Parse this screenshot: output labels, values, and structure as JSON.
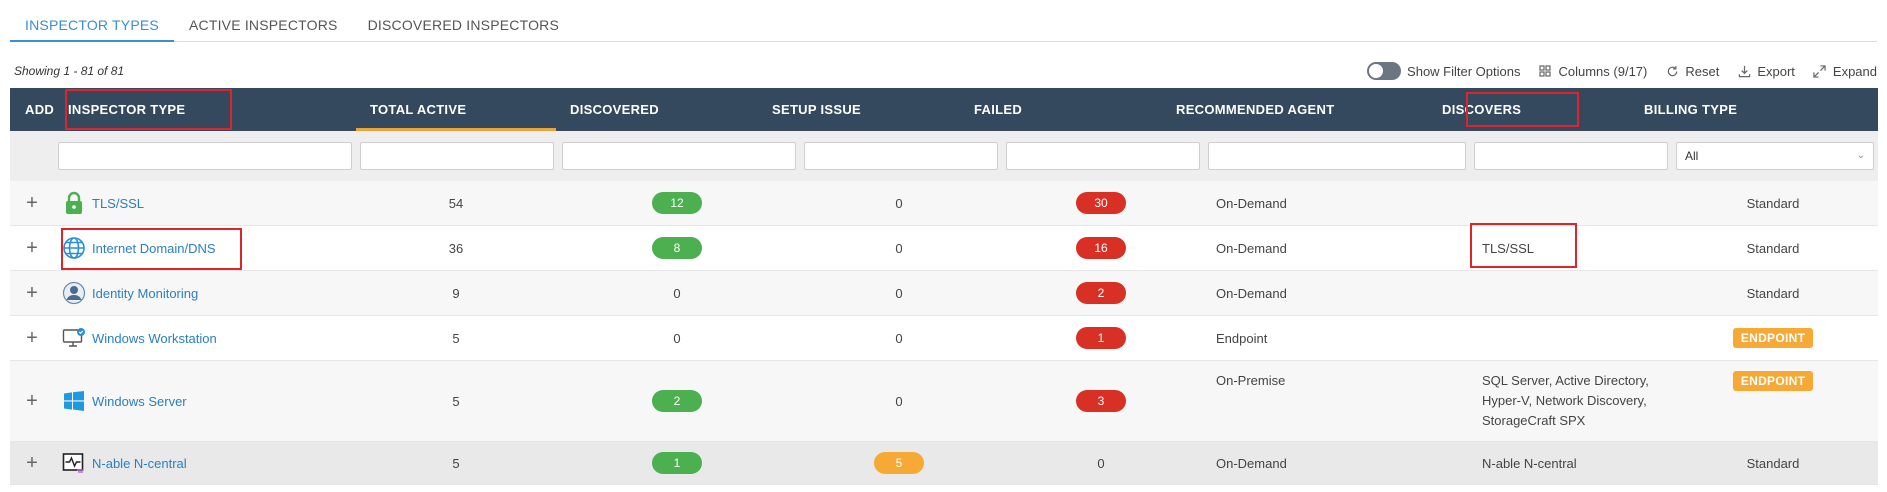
{
  "tabs": [
    {
      "label": "INSPECTOR TYPES",
      "active": true
    },
    {
      "label": "ACTIVE INSPECTORS",
      "active": false
    },
    {
      "label": "DISCOVERED INSPECTORS",
      "active": false
    }
  ],
  "showing": "Showing 1 - 81 of 81",
  "toolbar": {
    "filter_label": "Show Filter Options",
    "columns_label": "Columns (9/17)",
    "reset_label": "Reset",
    "export_label": "Export",
    "expand_label": "Expand"
  },
  "columns": {
    "add": "ADD",
    "type": "INSPECTOR TYPE",
    "total": "TOTAL ACTIVE",
    "discovered": "DISCOVERED",
    "setup": "SETUP ISSUE",
    "failed": "FAILED",
    "agent": "RECOMMENDED AGENT",
    "discovers": "DISCOVERS",
    "billing": "BILLING TYPE"
  },
  "filters": {
    "billing_selected": "All"
  },
  "rows": [
    {
      "type": "TLS/SSL",
      "icon": "lock-icon",
      "total": "54",
      "discovered": "12",
      "setup": "0",
      "failed": "30",
      "agent": "On-Demand",
      "discovers": "",
      "billing": "Standard"
    },
    {
      "type": "Internet Domain/DNS",
      "icon": "globe-icon",
      "total": "36",
      "discovered": "8",
      "setup": "0",
      "failed": "16",
      "agent": "On-Demand",
      "discovers": "TLS/SSL",
      "billing": "Standard"
    },
    {
      "type": "Identity Monitoring",
      "icon": "user-icon",
      "total": "9",
      "discovered": "0",
      "setup": "0",
      "failed": "2",
      "agent": "On-Demand",
      "discovers": "",
      "billing": "Standard"
    },
    {
      "type": "Windows Workstation",
      "icon": "workstation-icon",
      "total": "5",
      "discovered": "0",
      "setup": "0",
      "failed": "1",
      "agent": "Endpoint",
      "discovers": "",
      "billing": "ENDPOINT"
    },
    {
      "type": "Windows Server",
      "icon": "windows-icon",
      "total": "5",
      "discovered": "2",
      "setup": "0",
      "failed": "3",
      "agent": "On-Premise",
      "discovers_lines": [
        "SQL Server, Active Directory,",
        "Hyper-V, Network Discovery,",
        "StorageCraft SPX"
      ],
      "billing": "ENDPOINT"
    },
    {
      "type": "N-able N-central",
      "icon": "monitor-pulse-icon",
      "total": "5",
      "discovered": "1",
      "setup": "5",
      "failed": "0",
      "agent": "On-Demand",
      "discovers": "N-able N-central",
      "billing": "Standard"
    }
  ],
  "colors": {
    "header_bg": "#34495e",
    "accent": "#3a8fd0",
    "sort_underline": "#e8a33d",
    "badge_green": "#4caf50",
    "badge_red": "#d93025",
    "badge_orange": "#f6a935",
    "highlight_box": "#e0242b"
  }
}
